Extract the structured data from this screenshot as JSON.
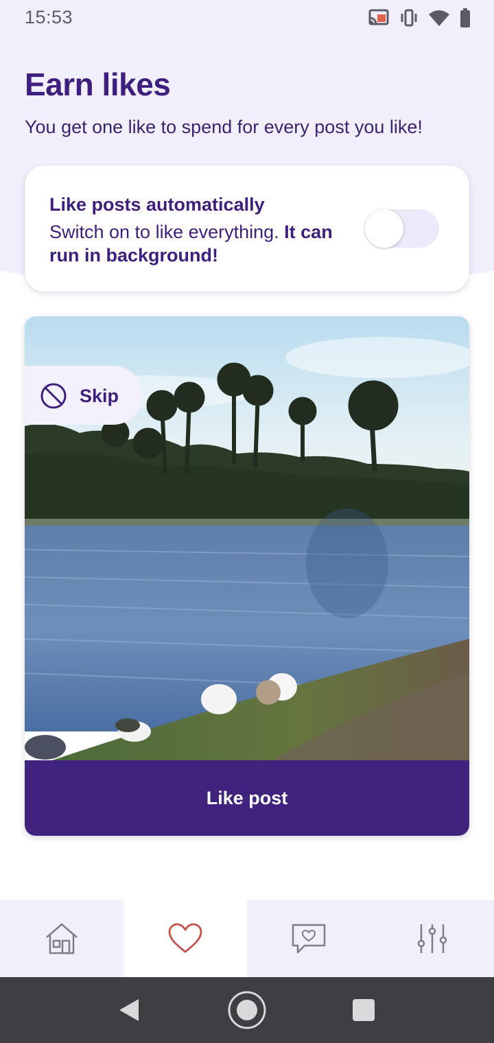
{
  "status_bar": {
    "time": "15:53",
    "icons": [
      "cast-icon",
      "vibrate-icon",
      "wifi-icon",
      "battery-icon"
    ]
  },
  "header": {
    "title": "Earn likes",
    "subtitle": "You get one like to spend for every post you like!"
  },
  "auto_like": {
    "title": "Like posts automatically",
    "description": "Switch on to like everything. ",
    "description_bold": "It can run in background!",
    "toggle_on": false
  },
  "post": {
    "skip_label": "Skip",
    "like_button_label": "Like post",
    "image_description": "lake-with-palm-trees-and-ducks"
  },
  "bottom_nav": {
    "items": [
      {
        "icon": "home-icon",
        "active": false
      },
      {
        "icon": "heart-icon",
        "active": true
      },
      {
        "icon": "heart-message-icon",
        "active": false
      },
      {
        "icon": "sliders-icon",
        "active": false
      }
    ]
  },
  "colors": {
    "accent": "#3f1f7e",
    "button": "#3f237d",
    "hero_bg": "#f1effc",
    "active_heart": "#c9504a"
  }
}
